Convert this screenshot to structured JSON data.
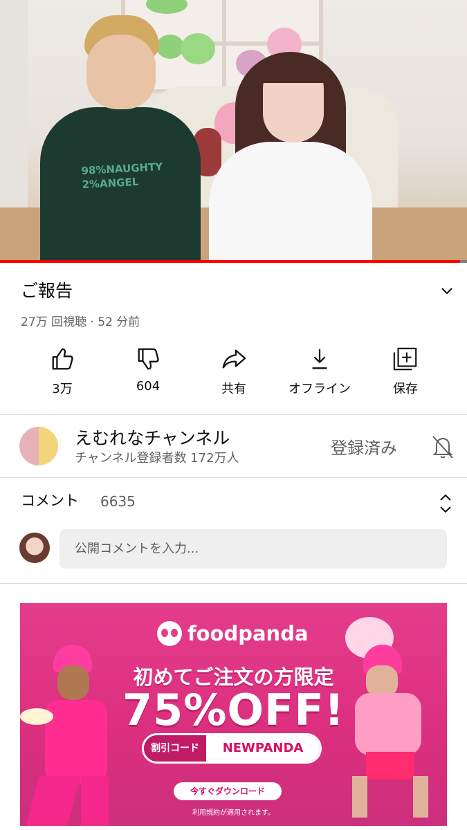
{
  "video": {
    "progress_percent": 98.5,
    "shirt_print": "98%NAUGHTY\n2%ANGEL"
  },
  "info": {
    "title": "ご報告",
    "meta": "27万 回視聴 · 52 分前"
  },
  "actions": [
    {
      "label": "3万",
      "icon": "thumbs-up-icon"
    },
    {
      "label": "604",
      "icon": "thumbs-down-icon"
    },
    {
      "label": "共有",
      "icon": "share-icon"
    },
    {
      "label": "オフライン",
      "icon": "download-icon"
    },
    {
      "label": "保存",
      "icon": "save-to-playlist-icon"
    }
  ],
  "channel": {
    "name": "えむれなチャンネル",
    "subscribers": "チャンネル登録者数 172万人",
    "subscribe_state": "登録済み"
  },
  "comments": {
    "heading": "コメント",
    "count": "6635",
    "placeholder": "公開コメントを入力..."
  },
  "ad": {
    "brand": "foodpanda",
    "headline": "初めてご注文の方限定",
    "offer": "75%OFF!",
    "code_label": "割引コード",
    "code": "NEWPANDA",
    "cta": "今すぐダウンロード",
    "terms": "利用規約が適用されます。",
    "colors": {
      "brand_pink": "#d70f64",
      "bg": "#e43d8c"
    }
  },
  "colors": {
    "progress": "#ff0000",
    "secondary_text": "#606060"
  }
}
